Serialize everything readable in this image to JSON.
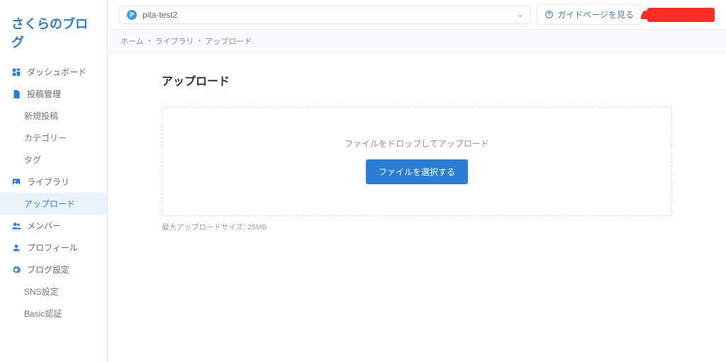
{
  "brand": "さくらのブログ",
  "topbar": {
    "selector_badge": "P",
    "selector_label": "pita-test2",
    "guide_label": "ガイドページを見る"
  },
  "breadcrumb": {
    "items": [
      "ホーム",
      "ライブラリ",
      "アップロード"
    ]
  },
  "sidebar": {
    "dashboard": "ダッシュボード",
    "posts": "投稿管理",
    "posts_new": "新規投稿",
    "posts_category": "カテゴリー",
    "posts_tag": "タグ",
    "library": "ライブラリ",
    "library_upload": "アップロード",
    "members": "メンバー",
    "profile": "プロフィール",
    "blog_settings": "ブログ設定",
    "sns": "SNS設定",
    "basic_auth": "Basic認証"
  },
  "page": {
    "title": "アップロード",
    "drop_text": "ファイルをドロップしてアップロード",
    "select_button": "ファイルを選択する",
    "max_size_hint": "最大アップロードサイズ: 25MB"
  }
}
